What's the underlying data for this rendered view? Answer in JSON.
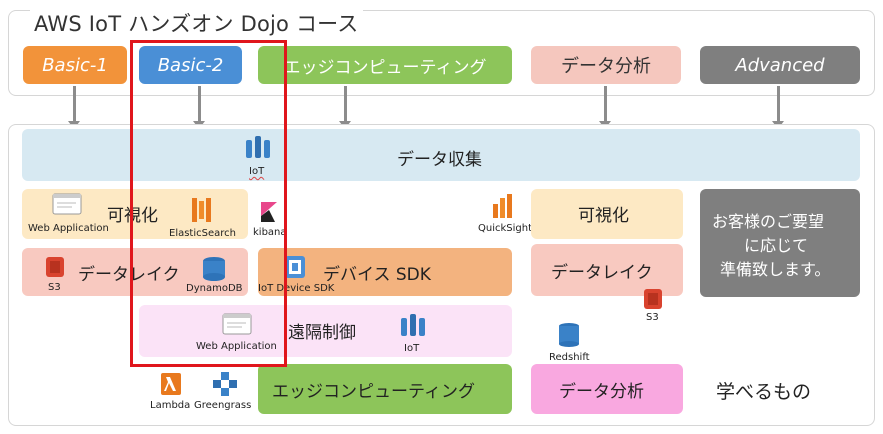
{
  "title": "AWS IoT ハンズオン Dojo コース",
  "courses": [
    {
      "label": "Basic-1",
      "color": "#f2933a"
    },
    {
      "label": "Basic-2",
      "color": "#4a8fd6"
    },
    {
      "label": "エッジコンピューティング",
      "color": "#8dc55a"
    },
    {
      "label": "データ分析",
      "color": "#f5c7be"
    },
    {
      "label": "Advanced",
      "color": "#7f7f7f"
    }
  ],
  "collect_bar": {
    "label": "データ収集",
    "icon_label": "IoT"
  },
  "blocks": {
    "visualize_left": {
      "label": "可視化",
      "web_app": "Web Application",
      "es": "ElasticSearch",
      "kibana": "kibana"
    },
    "datalake_left": {
      "label": "データレイク",
      "s3": "S3",
      "dynamo": "DynamoDB"
    },
    "device_sdk": {
      "label": "デバイス SDK",
      "icon_label": "IoT Device SDK"
    },
    "remote": {
      "label": "遠隔制御",
      "web_app": "Web Application",
      "iot": "IoT"
    },
    "edge_bottom": {
      "label": "エッジコンピューティング",
      "lambda": "Lambda",
      "greengrass": "Greengrass"
    },
    "visualize_right": {
      "label": "可視化",
      "quicksight": "QuickSight"
    },
    "datalake_right": {
      "label": "データレイク",
      "s3": "S3"
    },
    "analytics_bottom": {
      "label": "データ分析",
      "redshift": "Redshift"
    },
    "custom": {
      "line1": "お客様のご要望",
      "line2": "に応じて",
      "line3": "準備致します。"
    }
  },
  "learn_label": "学べるもの"
}
